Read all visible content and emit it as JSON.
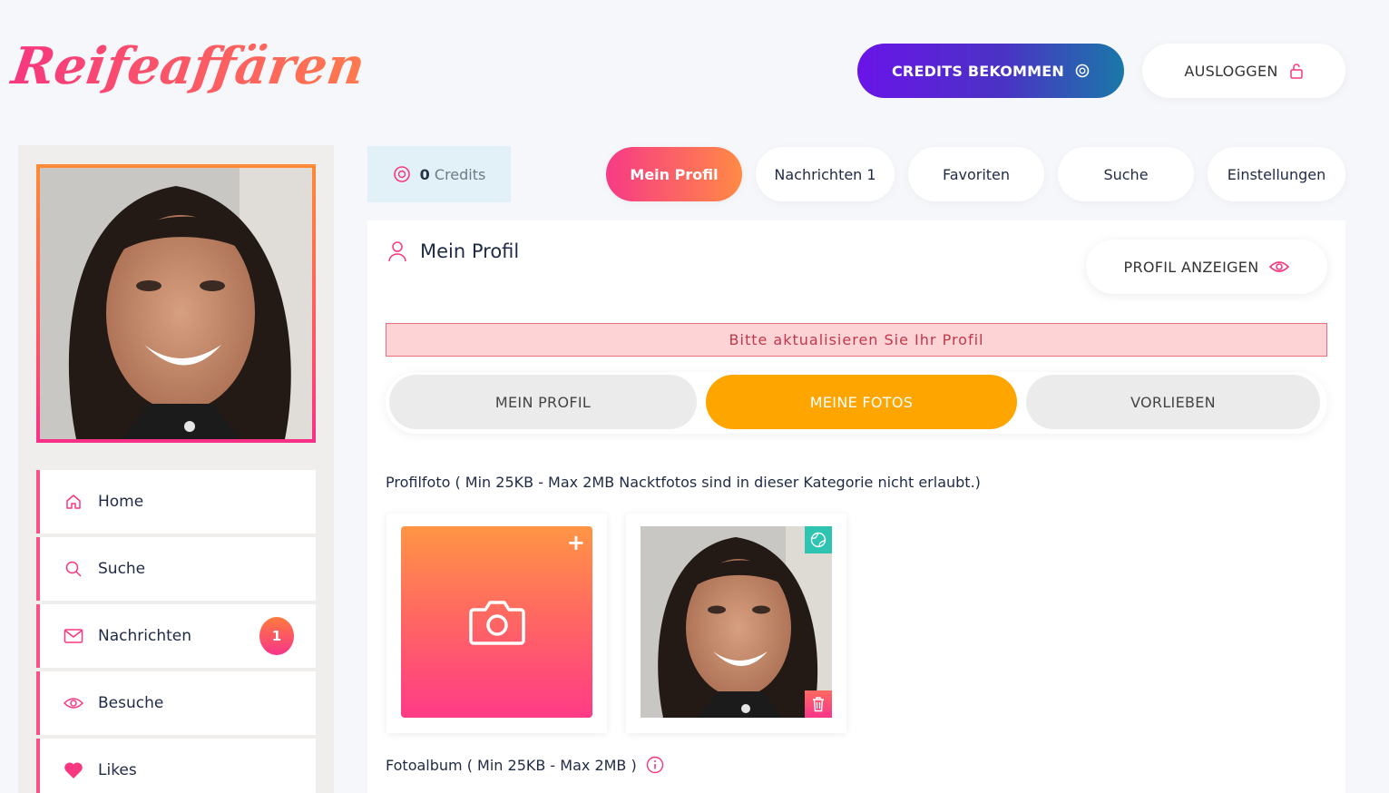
{
  "brand": {
    "logo_text": "Reifeaffären"
  },
  "header": {
    "credits_button": "CREDITS BEKOMMEN",
    "logout_button": "AUSLOGGEN"
  },
  "sidebar": {
    "items": [
      {
        "label": "Home",
        "icon": "home-icon"
      },
      {
        "label": "Suche",
        "icon": "search-icon"
      },
      {
        "label": "Nachrichten",
        "icon": "mail-icon",
        "badge": "1"
      },
      {
        "label": "Besuche",
        "icon": "eye-icon"
      },
      {
        "label": "Likes",
        "icon": "heart-icon"
      }
    ]
  },
  "topnav": {
    "credits_count": "0",
    "credits_label": "Credits",
    "tabs": [
      {
        "label": "Mein Profil",
        "active": true
      },
      {
        "label": "Nachrichten 1"
      },
      {
        "label": "Favoriten"
      },
      {
        "label": "Suche"
      },
      {
        "label": "Einstellungen"
      }
    ]
  },
  "main": {
    "title": "Mein Profil",
    "view_profile_button": "PROFIL ANZEIGEN",
    "alert": "Bitte aktualisieren Sie Ihr Profil",
    "tabs": [
      {
        "label": "MEIN PROFIL"
      },
      {
        "label": "MEINE FOTOS",
        "active": true
      },
      {
        "label": "VORLIEBEN"
      }
    ],
    "profile_photo_label": "Profilfoto ( Min 25KB - Max 2MB Nacktfotos sind in dieser Kategorie nicht erlaubt.)",
    "album_label": "Fotoalbum ( Min 25KB - Max 2MB )"
  },
  "colors": {
    "accent_pink": "#f73a86",
    "accent_orange": "#ff8a45",
    "tab_active": "#ffa500",
    "credits_gradient_start": "#6a14e8",
    "credits_gradient_end": "#1a78a8"
  }
}
